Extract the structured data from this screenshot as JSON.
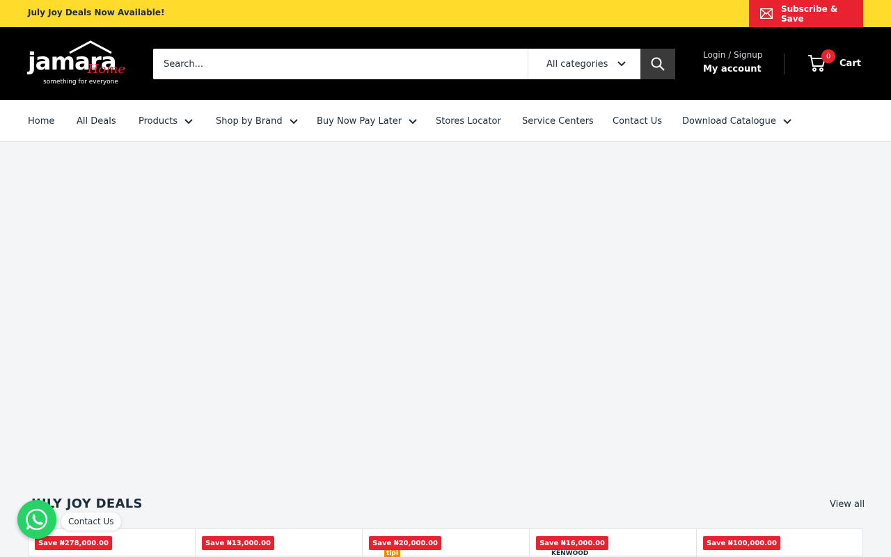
{
  "announcement": {
    "text": "July Joy Deals Now Available!",
    "subscribe_label": "Subscribe & Save"
  },
  "logo": {
    "main": "jamara",
    "accent": "Home",
    "tagline": "something for everyone"
  },
  "search": {
    "placeholder": "Search...",
    "category_label": "All categories"
  },
  "account": {
    "login_label": "Login / Signup",
    "my_account_label": "My account"
  },
  "cart": {
    "count": "0",
    "label": "Cart"
  },
  "nav": {
    "items": [
      {
        "label": "Home"
      },
      {
        "label": "All Deals"
      },
      {
        "label": "Products"
      },
      {
        "label": "Shop by Brand"
      },
      {
        "label": "Buy Now Pay Later"
      },
      {
        "label": "Stores Locator"
      },
      {
        "label": "Service Centers"
      },
      {
        "label": "Contact Us"
      },
      {
        "label": "Download Catalogue"
      }
    ]
  },
  "deals": {
    "title": "JULY JOY DEALS",
    "view_all": "View all",
    "cards": [
      {
        "badge": "Save ₦278,000.00"
      },
      {
        "badge": "Save ₦13,000.00"
      },
      {
        "badge": "Save ₦20,000.00",
        "brand": "tipi"
      },
      {
        "badge": "Save ₦16,000.00",
        "brand": "KENWOOD"
      },
      {
        "badge": "Save ₦100,000.00"
      }
    ]
  },
  "whatsapp": {
    "label": "Contact Us"
  },
  "colors": {
    "accent_yellow": "#ffdb2b",
    "accent_red": "#e8222f",
    "header_bg": "#000000",
    "whatsapp_green": "#25d366",
    "text_dark": "#1e2d3b"
  }
}
